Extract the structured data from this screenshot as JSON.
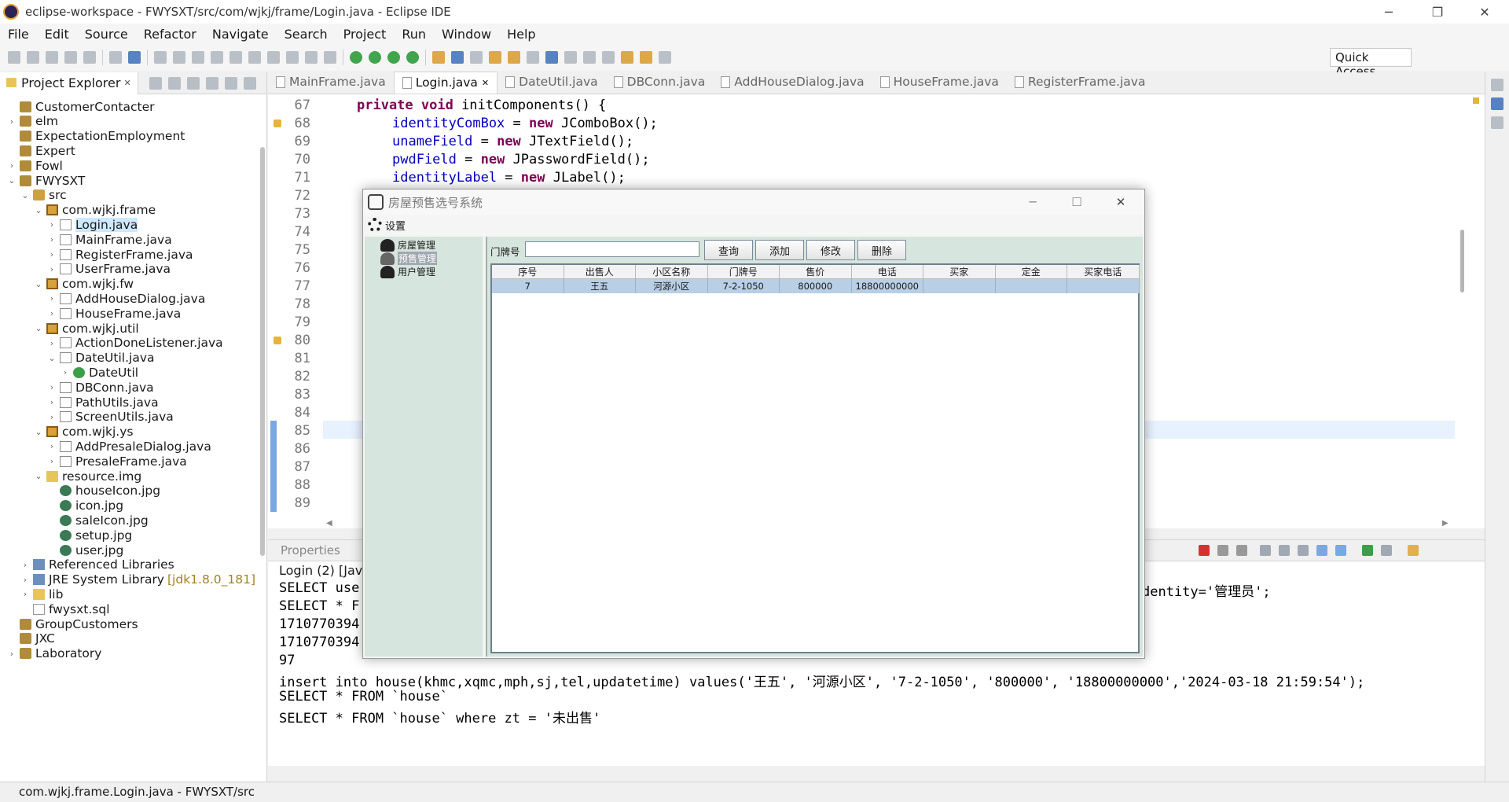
{
  "window": {
    "title": "eclipse-workspace - FWYSXT/src/com/wjkj/frame/Login.java - Eclipse IDE",
    "minimize": "─",
    "restore": "❐",
    "close": "✕"
  },
  "menu": [
    "File",
    "Edit",
    "Source",
    "Refactor",
    "Navigate",
    "Search",
    "Project",
    "Run",
    "Window",
    "Help"
  ],
  "quick_access": "Quick Access",
  "explorer": {
    "tab_label": "Project Explorer",
    "tab_close": "✕",
    "items": [
      {
        "label": "CustomerContacter",
        "icon": "project-icon",
        "twisty": ""
      },
      {
        "label": "elm",
        "icon": "project-icon",
        "twisty": "›"
      },
      {
        "label": "ExpectationEmployment",
        "icon": "project-icon",
        "twisty": ""
      },
      {
        "label": "Expert",
        "icon": "project-icon",
        "twisty": ""
      },
      {
        "label": "Fowl",
        "icon": "project-icon",
        "twisty": "›"
      },
      {
        "label": "FWYSXT",
        "icon": "project-icon",
        "twisty": "⌄"
      },
      {
        "label": "src",
        "icon": "source-folder-icon",
        "twisty": "⌄"
      },
      {
        "label": "com.wjkj.frame",
        "icon": "package-icon",
        "twisty": "⌄"
      },
      {
        "label": "Login.java",
        "icon": "java-file-icon",
        "twisty": "›"
      },
      {
        "label": "MainFrame.java",
        "icon": "java-file-icon",
        "twisty": "›"
      },
      {
        "label": "RegisterFrame.java",
        "icon": "java-file-icon",
        "twisty": "›"
      },
      {
        "label": "UserFrame.java",
        "icon": "java-file-icon",
        "twisty": "›"
      },
      {
        "label": "com.wjkj.fw",
        "icon": "package-icon",
        "twisty": "⌄"
      },
      {
        "label": "AddHouseDialog.java",
        "icon": "java-file-icon",
        "twisty": "›"
      },
      {
        "label": "HouseFrame.java",
        "icon": "java-file-icon",
        "twisty": "›"
      },
      {
        "label": "com.wjkj.util",
        "icon": "package-icon",
        "twisty": "⌄"
      },
      {
        "label": "ActionDoneListener.java",
        "icon": "java-file-icon",
        "twisty": "›"
      },
      {
        "label": "DateUtil.java",
        "icon": "java-file-icon",
        "twisty": "⌄"
      },
      {
        "label": "DateUtil",
        "icon": "class-icon",
        "twisty": "›"
      },
      {
        "label": "DBConn.java",
        "icon": "java-file-icon",
        "twisty": "›"
      },
      {
        "label": "PathUtils.java",
        "icon": "java-file-icon",
        "twisty": "›"
      },
      {
        "label": "ScreenUtils.java",
        "icon": "java-file-icon",
        "twisty": "›"
      },
      {
        "label": "com.wjkj.ys",
        "icon": "package-icon",
        "twisty": "⌄"
      },
      {
        "label": "AddPresaleDialog.java",
        "icon": "java-file-icon",
        "twisty": "›"
      },
      {
        "label": "PresaleFrame.java",
        "icon": "java-file-icon",
        "twisty": "›"
      },
      {
        "label": "resource.img",
        "icon": "folder-icon",
        "twisty": "⌄"
      },
      {
        "label": "houseIcon.jpg",
        "icon": "image-file-icon",
        "twisty": ""
      },
      {
        "label": "icon.jpg",
        "icon": "image-file-icon",
        "twisty": ""
      },
      {
        "label": "saleIcon.jpg",
        "icon": "image-file-icon",
        "twisty": ""
      },
      {
        "label": "setup.jpg",
        "icon": "image-file-icon",
        "twisty": ""
      },
      {
        "label": "user.jpg",
        "icon": "image-file-icon",
        "twisty": ""
      },
      {
        "label": "Referenced Libraries",
        "icon": "library-icon",
        "twisty": "›"
      },
      {
        "label": "JRE System Library",
        "icon": "library-icon",
        "twisty": "›",
        "suffix": "[jdk1.8.0_181]"
      },
      {
        "label": "lib",
        "icon": "folder-icon",
        "twisty": "›"
      },
      {
        "label": "fwysxt.sql",
        "icon": "sql-file-icon",
        "twisty": ""
      },
      {
        "label": "GroupCustomers",
        "icon": "project-icon",
        "twisty": ""
      },
      {
        "label": "JXC",
        "icon": "project-icon",
        "twisty": ""
      },
      {
        "label": "Laboratory",
        "icon": "project-icon",
        "twisty": "›"
      }
    ]
  },
  "editor": {
    "tabs": [
      {
        "label": "MainFrame.java",
        "active": false
      },
      {
        "label": "Login.java",
        "active": true
      },
      {
        "label": "DateUtil.java",
        "active": false
      },
      {
        "label": "DBConn.java",
        "active": false
      },
      {
        "label": "AddHouseDialog.java",
        "active": false
      },
      {
        "label": "HouseFrame.java",
        "active": false
      },
      {
        "label": "RegisterFrame.java",
        "active": false
      }
    ],
    "tab_close": "✕",
    "line_numbers": [
      "67",
      "68",
      "69",
      "70",
      "71",
      "72",
      "73",
      "74",
      "75",
      "76",
      "77",
      "78",
      "79",
      "80",
      "81",
      "82",
      "83",
      "84",
      "85",
      "86",
      "87",
      "88",
      "89"
    ],
    "code": {
      "l67_kw": "private void",
      "l67_rest": " initComponents() {",
      "l68_field": "identityComBox",
      "l68_eq": " = ",
      "l68_kw": "new",
      "l68_rest": " JComboBox();",
      "l69_field": "unameField",
      "l69_eq": " = ",
      "l69_kw": "new",
      "l69_rest": " JTextField();",
      "l70_field": "pwdField",
      "l70_eq": " = ",
      "l70_kw": "new",
      "l70_rest": " JPasswordField();",
      "l71_field": "identityLabel",
      "l71_eq": " = ",
      "l71_kw": "new",
      "l71_rest": " JLabel();"
    }
  },
  "console": {
    "tab_label": "Properties",
    "header": "Login (2) [Java",
    "lines": [
      "SELECT use",
      "SELECT * F",
      "1710770394",
      "1710770394",
      "97",
      "insert into house(khmc,xqmc,mph,sj,tel,updatetime) values('王五', '河源小区', '7-2-1050', '800000', '18800000000','2024-03-18 21:59:54');",
      "SELECT * FROM `house`",
      "SELECT * FROM `house` where zt = '未出售'"
    ],
    "line1_tail": "dentity='管理员';"
  },
  "status_bar": "com.wjkj.frame.Login.java - FWYSXT/src",
  "dialog": {
    "title": "房屋预售选号系统",
    "menu_label": "设置",
    "nav": [
      {
        "label": "房屋管理",
        "icon": "house-icon"
      },
      {
        "label": "预售管理",
        "icon": "presale-icon",
        "selected": true
      },
      {
        "label": "用户管理",
        "icon": "user-icon"
      }
    ],
    "search_label": "门牌号",
    "search_value": "",
    "buttons": {
      "query": "查询",
      "add": "添加",
      "edit": "修改",
      "delete": "删除"
    },
    "table": {
      "headers": [
        "序号",
        "出售人",
        "小区名称",
        "门牌号",
        "售价",
        "电话",
        "买家",
        "定金",
        "买家电话"
      ],
      "rows": [
        [
          "7",
          "王五",
          "河源小区",
          "7-2-1050",
          "800000",
          "18800000000",
          "",
          "",
          ""
        ]
      ]
    }
  },
  "colors": {
    "keyword": "#7f0055",
    "field": "#0000c0",
    "dialog_panel": "#d6e5dd",
    "table_selection": "#b8cfe5"
  }
}
